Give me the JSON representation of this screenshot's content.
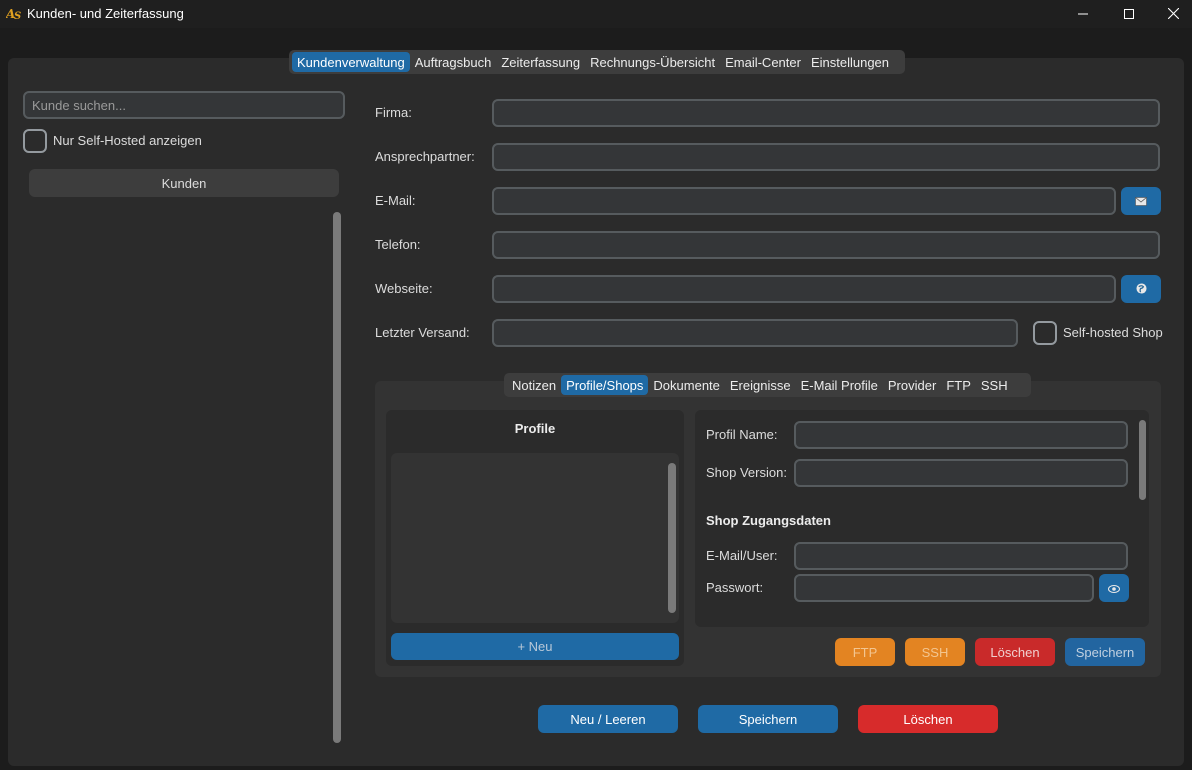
{
  "window": {
    "title": "Kunden- und Zeiterfassung",
    "icon": "app-logo-icon",
    "controls": {
      "minimize": "minimize-icon",
      "maximize": "maximize-icon",
      "close": "close-icon"
    }
  },
  "main_tabs": [
    {
      "label": "Kundenverwaltung",
      "active": true
    },
    {
      "label": "Auftragsbuch",
      "active": false
    },
    {
      "label": "Zeiterfassung",
      "active": false
    },
    {
      "label": "Rechnungs-Übersicht",
      "active": false
    },
    {
      "label": "Email-Center",
      "active": false
    },
    {
      "label": "Einstellungen",
      "active": false
    }
  ],
  "sidebar": {
    "search_placeholder": "Kunde suchen...",
    "self_hosted_filter_label": "Nur Self-Hosted anzeigen",
    "list_header": "Kunden"
  },
  "form": {
    "firma_label": "Firma:",
    "ansprechpartner_label": "Ansprechpartner:",
    "email_label": "E-Mail:",
    "telefon_label": "Telefon:",
    "webseite_label": "Webseite:",
    "letzter_versand_label": "Letzter Versand:",
    "self_hosted_label": "Self-hosted Shop",
    "email_button_icon": "mail-icon",
    "web_button_icon": "globe-icon"
  },
  "sub_tabs": [
    {
      "label": "Notizen",
      "active": false
    },
    {
      "label": "Profile/Shops",
      "active": true
    },
    {
      "label": "Dokumente",
      "active": false
    },
    {
      "label": "Ereignisse",
      "active": false
    },
    {
      "label": "E-Mail Profile",
      "active": false
    },
    {
      "label": "Provider",
      "active": false
    },
    {
      "label": "FTP",
      "active": false
    },
    {
      "label": "SSH",
      "active": false
    }
  ],
  "profiles": {
    "header": "Profile",
    "new_button": "+ Neu"
  },
  "profile_detail": {
    "profil_name_label": "Profil Name:",
    "shop_version_label": "Shop Version:",
    "zugangsdaten_heading": "Shop Zugangsdaten",
    "email_user_label": "E-Mail/User:",
    "passwort_label": "Passwort:",
    "show_password_icon": "eye-icon"
  },
  "profile_actions": {
    "ftp": "FTP",
    "ssh": "SSH",
    "delete": "Löschen",
    "save": "Speichern"
  },
  "bottom_actions": {
    "new_clear": "Neu / Leeren",
    "save": "Speichern",
    "delete": "Löschen"
  },
  "colors": {
    "accent": "#1f6aa5",
    "danger": "#d72b2b",
    "warning": "#e38422"
  }
}
